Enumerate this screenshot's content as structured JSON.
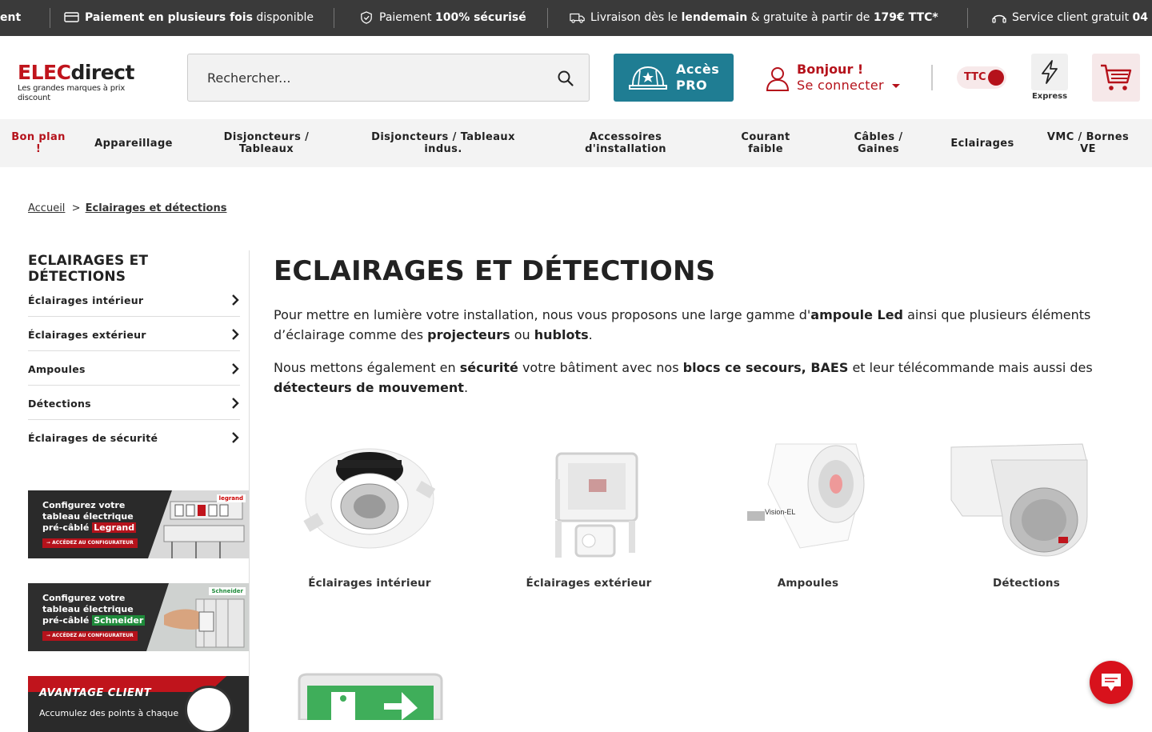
{
  "topbar": {
    "msg0": "ent",
    "msg1_bold": "Paiement en plusieurs fois",
    "msg1_rest": " disponible",
    "msg2_pre": "Paiement ",
    "msg2_bold": "100% sécurisé",
    "msg3_pre": "Livraison dès le ",
    "msg3_bold1": "lendemain",
    "msg3_mid": " & gratuite à partir de ",
    "msg3_bold2": "179€ TTC*",
    "msg4_pre": "Service client gratuit ",
    "msg4_bold": "04"
  },
  "header": {
    "logo_part1": "ELEC",
    "logo_part2": "direct",
    "logo_tagline": "Les grandes marques à prix discount",
    "search_placeholder": "Rechercher...",
    "pro_line1": "Accès",
    "pro_line2": "PRO",
    "account_hello": "Bonjour !",
    "account_login": "Se connecter",
    "ttc_label": "TTC",
    "express_label": "Express"
  },
  "nav": {
    "items": [
      {
        "label": "Bon plan !"
      },
      {
        "label": "Appareillage"
      },
      {
        "label": "Disjoncteurs / Tableaux"
      },
      {
        "label": "Disjoncteurs / Tableaux indus."
      },
      {
        "label": "Accessoires d'installation"
      },
      {
        "label": "Courant faible"
      },
      {
        "label": "Câbles / Gaines"
      },
      {
        "label": "Eclairages"
      },
      {
        "label": "VMC / Bornes VE"
      }
    ]
  },
  "breadcrumb": {
    "home": "Accueil",
    "sep": ">",
    "current": "Eclairages et détections"
  },
  "sidebar": {
    "title": "ECLAIRAGES ET DÉTECTIONS",
    "items": [
      {
        "label": "Éclairages intérieur"
      },
      {
        "label": "Éclairages extérieur"
      },
      {
        "label": "Ampoules"
      },
      {
        "label": "Détections"
      },
      {
        "label": "Éclairages de sécurité"
      }
    ],
    "banner1": {
      "l1": "Configurez votre",
      "l2": "tableau électrique",
      "l3": "pré-câblé ",
      "brand": "Legrand",
      "cta": "➞ ACCÉDEZ AU CONFIGURATEUR",
      "logo": "legrand"
    },
    "banner2": {
      "l1": "Configurez votre",
      "l2": "tableau électrique",
      "l3": "pré-câblé ",
      "brand": "Schneider",
      "cta": "➞ ACCÉDEZ AU CONFIGURATEUR",
      "logo": "Schneider"
    },
    "banner3": {
      "title": "AVANTAGE CLIENT",
      "sub": "Accumulez des points à chaque"
    }
  },
  "main": {
    "title": "ECLAIRAGES ET DÉTECTIONS",
    "p1": {
      "t1": "Pour mettre en lumière votre installation, nous vous proposons une large gamme d'",
      "b1": "ampoule Led",
      "t2": " ainsi que plusieurs éléments d’éclairage comme des ",
      "b2": "projecteurs",
      "t3": " ou ",
      "b3": "hublots",
      "t4": "."
    },
    "p2": {
      "t1": "Nous mettons également en ",
      "b1": "sécurité",
      "t2": " votre bâtiment avec nos ",
      "b2": "blocs ce secours, BAES",
      "t3": " et leur télécommande mais aussi des ",
      "b3": "détecteurs de mouvement",
      "t4": "."
    },
    "categories": [
      {
        "label": "Éclairages intérieur",
        "icon": "downlight-icon"
      },
      {
        "label": "Éclairages extérieur",
        "icon": "floodlight-icon"
      },
      {
        "label": "Ampoules",
        "icon": "bulb-icon"
      },
      {
        "label": "Détections",
        "icon": "motion-detector-icon"
      },
      {
        "label": "",
        "icon": "emergency-exit-icon"
      }
    ]
  },
  "colors": {
    "brand_red": "#b5121b",
    "pro_blue": "#1f7d93",
    "topbar_bg": "#3a3a3a"
  }
}
